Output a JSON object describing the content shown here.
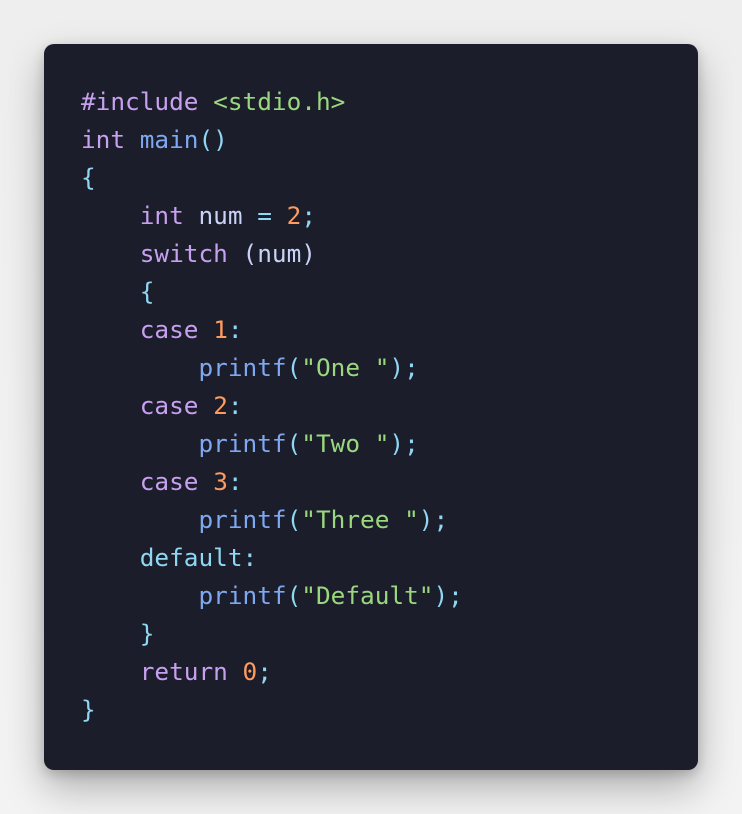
{
  "code_block": {
    "language": "c",
    "lines": [
      {
        "indent": "",
        "tokens": [
          {
            "text": "#include",
            "type": "preproc"
          },
          {
            "text": " ",
            "type": "space"
          },
          {
            "text": "<stdio.h>",
            "type": "header"
          }
        ]
      },
      {
        "indent": "",
        "tokens": [
          {
            "text": "int",
            "type": "keyword"
          },
          {
            "text": " ",
            "type": "space"
          },
          {
            "text": "main",
            "type": "func"
          },
          {
            "text": "()",
            "type": "punct"
          }
        ]
      },
      {
        "indent": "",
        "tokens": [
          {
            "text": "{",
            "type": "punct"
          }
        ]
      },
      {
        "indent": "    ",
        "tokens": [
          {
            "text": "int",
            "type": "keyword"
          },
          {
            "text": " num ",
            "type": "ident"
          },
          {
            "text": "=",
            "type": "punct"
          },
          {
            "text": " ",
            "type": "space"
          },
          {
            "text": "2",
            "type": "number"
          },
          {
            "text": ";",
            "type": "punct"
          }
        ]
      },
      {
        "indent": "    ",
        "tokens": [
          {
            "text": "switch",
            "type": "keyword"
          },
          {
            "text": " (num)",
            "type": "ident"
          }
        ]
      },
      {
        "indent": "    ",
        "tokens": [
          {
            "text": "{",
            "type": "punct"
          }
        ]
      },
      {
        "indent": "    ",
        "tokens": [
          {
            "text": "case",
            "type": "keyword"
          },
          {
            "text": " ",
            "type": "space"
          },
          {
            "text": "1",
            "type": "number"
          },
          {
            "text": ":",
            "type": "punct"
          }
        ]
      },
      {
        "indent": "        ",
        "tokens": [
          {
            "text": "printf",
            "type": "func"
          },
          {
            "text": "(",
            "type": "punct"
          },
          {
            "text": "\"One \"",
            "type": "string"
          },
          {
            "text": ");",
            "type": "punct"
          }
        ]
      },
      {
        "indent": "    ",
        "tokens": [
          {
            "text": "case",
            "type": "keyword"
          },
          {
            "text": " ",
            "type": "space"
          },
          {
            "text": "2",
            "type": "number"
          },
          {
            "text": ":",
            "type": "punct"
          }
        ]
      },
      {
        "indent": "        ",
        "tokens": [
          {
            "text": "printf",
            "type": "func"
          },
          {
            "text": "(",
            "type": "punct"
          },
          {
            "text": "\"Two \"",
            "type": "string"
          },
          {
            "text": ");",
            "type": "punct"
          }
        ]
      },
      {
        "indent": "    ",
        "tokens": [
          {
            "text": "case",
            "type": "keyword"
          },
          {
            "text": " ",
            "type": "space"
          },
          {
            "text": "3",
            "type": "number"
          },
          {
            "text": ":",
            "type": "punct"
          }
        ]
      },
      {
        "indent": "        ",
        "tokens": [
          {
            "text": "printf",
            "type": "func"
          },
          {
            "text": "(",
            "type": "punct"
          },
          {
            "text": "\"Three \"",
            "type": "string"
          },
          {
            "text": ");",
            "type": "punct"
          }
        ]
      },
      {
        "indent": "    ",
        "tokens": [
          {
            "text": "default:",
            "type": "default"
          }
        ]
      },
      {
        "indent": "        ",
        "tokens": [
          {
            "text": "printf",
            "type": "func"
          },
          {
            "text": "(",
            "type": "punct"
          },
          {
            "text": "\"Default\"",
            "type": "string"
          },
          {
            "text": ");",
            "type": "punct"
          }
        ]
      },
      {
        "indent": "    ",
        "tokens": [
          {
            "text": "}",
            "type": "punct"
          }
        ]
      },
      {
        "indent": "    ",
        "tokens": [
          {
            "text": "return",
            "type": "keyword"
          },
          {
            "text": " ",
            "type": "space"
          },
          {
            "text": "0",
            "type": "number"
          },
          {
            "text": ";",
            "type": "punct"
          }
        ]
      },
      {
        "indent": "",
        "tokens": [
          {
            "text": "}",
            "type": "punct"
          }
        ]
      }
    ]
  },
  "colors": {
    "page_background": "#efefef",
    "card_background": "#1b1d2a",
    "preproc": "#c7a0f0",
    "header": "#9ad77e",
    "keyword": "#c7a0f0",
    "function": "#7fa8f2",
    "punctuation": "#8fd7f2",
    "identifier": "#c9d3f5",
    "number": "#ff9b5e",
    "string": "#9ad77e",
    "default_label": "#8fd7f2"
  }
}
